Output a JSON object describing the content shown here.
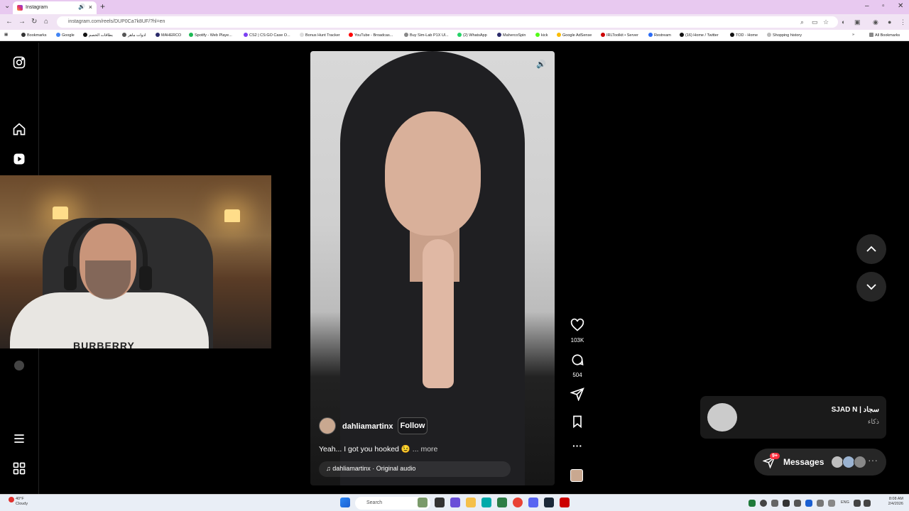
{
  "browser": {
    "tab_title": "Instagram",
    "url": "instagram.com/reels/DUP0Ca7k8UF/?hl=en",
    "bookmarks": [
      "Bookmarks",
      "Google",
      "بطاقات الخصم",
      "ادوات ماهر",
      "MAHERCO",
      "Spotify - Web Playe...",
      "CS2 | CS:GO Case O...",
      "Bonus Hunt Tracker",
      "YouTube - Broadcas...",
      "Buy Sim-Lab P1X Ul...",
      "(2) WhatsApp",
      "MahercoSpin",
      "kick",
      "Google AdSense",
      "IRLToolkit • Server",
      "Restream",
      "(16) Home / Twitter",
      "TOD - Home",
      "Shopping history"
    ],
    "all_bookmarks": "All Bookmarks"
  },
  "reel": {
    "username": "dahliamartinx",
    "follow_label": "Follow",
    "caption": "Yeah... I got you hooked 😉",
    "more_label": "... more",
    "audio": "dahliamartinx · Original audio",
    "likes": "103K",
    "comments": "504"
  },
  "webcam": {
    "shirt_text": "BURBERRY"
  },
  "notification": {
    "name": "SJAD N | سجاد",
    "message": "ذكاء"
  },
  "messages": {
    "label": "Messages",
    "badge": "9+"
  },
  "taskbar": {
    "weather_temp": "40°F",
    "weather_desc": "Cloudy",
    "search_placeholder": "Search",
    "lang": "ENG",
    "time": "8:08 AM",
    "date": "2/4/2026"
  },
  "colors": {
    "tab_strip": "#e8c9f0",
    "background": "#000000",
    "badge": "#ff3040"
  }
}
